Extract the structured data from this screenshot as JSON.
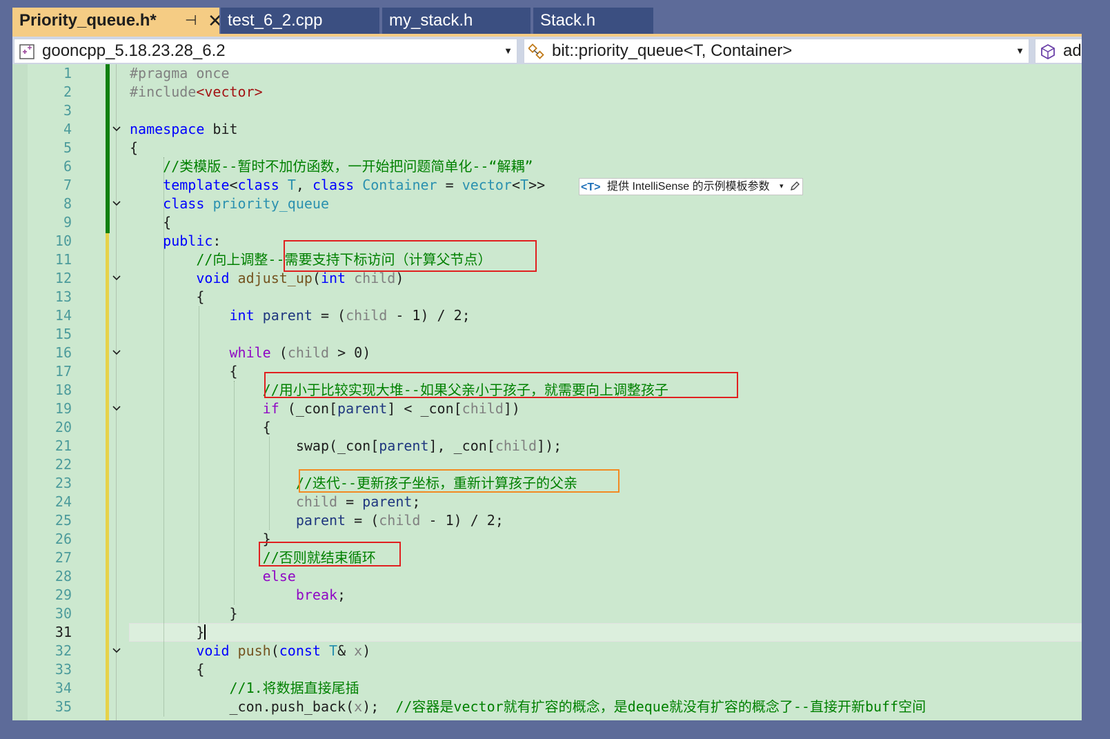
{
  "tabs": [
    {
      "label": "Priority_queue.h*",
      "active": true
    },
    {
      "label": "test_6_2.cpp",
      "active": false
    },
    {
      "label": "my_stack.h",
      "active": false
    },
    {
      "label": "Stack.h",
      "active": false
    }
  ],
  "tab_pin_icon": "pin-icon",
  "tab_close_icon": "close-icon",
  "navbar": {
    "project": "gooncpp_5.18.23.28_6.2",
    "scope": "bit::priority_queue<T, Container>",
    "member": "ad"
  },
  "intellisense": {
    "badge": "<T>",
    "text": "提供 IntelliSense 的示例模板参数",
    "arrow": "▾"
  },
  "current_line": 31,
  "lines": [
    {
      "n": "1",
      "t": [
        [
          "#pragma once",
          "pp"
        ]
      ]
    },
    {
      "n": "2",
      "t": [
        [
          "#include",
          "pp"
        ],
        [
          "<vector>",
          "str"
        ]
      ]
    },
    {
      "n": "3",
      "t": []
    },
    {
      "n": "4",
      "t": [
        [
          "namespace",
          "kw"
        ],
        [
          " bit",
          "pl"
        ]
      ]
    },
    {
      "n": "5",
      "t": [
        [
          "{",
          "pl"
        ]
      ]
    },
    {
      "n": "6",
      "t": [
        [
          "    ",
          "pl"
        ],
        [
          "//类模版--暂时不加仿函数，一开始把问题简单化--“解耦”",
          "cm"
        ]
      ]
    },
    {
      "n": "7",
      "t": [
        [
          "    ",
          "pl"
        ],
        [
          "template",
          "kw"
        ],
        [
          "<",
          "pl"
        ],
        [
          "class",
          "kw"
        ],
        [
          " ",
          "pl"
        ],
        [
          "T",
          "type"
        ],
        [
          ", ",
          "pl"
        ],
        [
          "class",
          "kw"
        ],
        [
          " ",
          "pl"
        ],
        [
          "Container",
          "type"
        ],
        [
          " = ",
          "pl"
        ],
        [
          "vector",
          "type"
        ],
        [
          "<",
          "pl"
        ],
        [
          "T",
          "type"
        ],
        [
          ">>",
          "pl"
        ]
      ]
    },
    {
      "n": "8",
      "t": [
        [
          "    ",
          "pl"
        ],
        [
          "class",
          "kw"
        ],
        [
          " ",
          "pl"
        ],
        [
          "priority_queue",
          "type"
        ]
      ]
    },
    {
      "n": "9",
      "t": [
        [
          "    {",
          "pl"
        ]
      ]
    },
    {
      "n": "10",
      "t": [
        [
          "    ",
          "pl"
        ],
        [
          "public",
          "kw"
        ],
        [
          ":",
          "pl"
        ]
      ]
    },
    {
      "n": "11",
      "t": [
        [
          "        ",
          "pl"
        ],
        [
          "//向上调整--需要支持下标访问（计算父节点）",
          "cm"
        ]
      ]
    },
    {
      "n": "12",
      "t": [
        [
          "        ",
          "pl"
        ],
        [
          "void",
          "kw"
        ],
        [
          " ",
          "pl"
        ],
        [
          "adjust_up",
          "fn"
        ],
        [
          "(",
          "pl"
        ],
        [
          "int",
          "kw"
        ],
        [
          " ",
          "pl"
        ],
        [
          "child",
          "par"
        ],
        [
          ")",
          "pl"
        ]
      ]
    },
    {
      "n": "13",
      "t": [
        [
          "        {",
          "pl"
        ]
      ]
    },
    {
      "n": "14",
      "t": [
        [
          "            ",
          "pl"
        ],
        [
          "int",
          "kw"
        ],
        [
          " ",
          "pl"
        ],
        [
          "parent",
          "mem"
        ],
        [
          " = (",
          "pl"
        ],
        [
          "child",
          "par"
        ],
        [
          " - 1) / 2;",
          "pl"
        ]
      ]
    },
    {
      "n": "15",
      "t": []
    },
    {
      "n": "16",
      "t": [
        [
          "            ",
          "pl"
        ],
        [
          "while",
          "ctrl"
        ],
        [
          " (",
          "pl"
        ],
        [
          "child",
          "par"
        ],
        [
          " > 0)",
          "pl"
        ]
      ]
    },
    {
      "n": "17",
      "t": [
        [
          "            {",
          "pl"
        ]
      ]
    },
    {
      "n": "18",
      "t": [
        [
          "                ",
          "pl"
        ],
        [
          "//用小于比较实现大堆--如果父亲小于孩子，就需要向上调整孩子",
          "cm"
        ]
      ]
    },
    {
      "n": "19",
      "t": [
        [
          "                ",
          "pl"
        ],
        [
          "if",
          "ctrl"
        ],
        [
          " (_con[",
          "pl"
        ],
        [
          "parent",
          "mem"
        ],
        [
          "] < _con[",
          "pl"
        ],
        [
          "child",
          "par"
        ],
        [
          "])",
          "pl"
        ]
      ]
    },
    {
      "n": "20",
      "t": [
        [
          "                {",
          "pl"
        ]
      ]
    },
    {
      "n": "21",
      "t": [
        [
          "                    ",
          "pl"
        ],
        [
          "swap",
          "pl"
        ],
        [
          "(_con[",
          "pl"
        ],
        [
          "parent",
          "mem"
        ],
        [
          "], _con[",
          "pl"
        ],
        [
          "child",
          "par"
        ],
        [
          "]);",
          "pl"
        ]
      ]
    },
    {
      "n": "22",
      "t": []
    },
    {
      "n": "23",
      "t": [
        [
          "                    ",
          "pl"
        ],
        [
          "//迭代--更新孩子坐标，重新计算孩子的父亲",
          "cm"
        ]
      ]
    },
    {
      "n": "24",
      "t": [
        [
          "                    ",
          "pl"
        ],
        [
          "child",
          "par"
        ],
        [
          " = ",
          "pl"
        ],
        [
          "parent",
          "mem"
        ],
        [
          ";",
          "pl"
        ]
      ]
    },
    {
      "n": "25",
      "t": [
        [
          "                    ",
          "pl"
        ],
        [
          "parent",
          "mem"
        ],
        [
          " = (",
          "pl"
        ],
        [
          "child",
          "par"
        ],
        [
          " - 1) / 2;",
          "pl"
        ]
      ]
    },
    {
      "n": "26",
      "t": [
        [
          "                }",
          "pl"
        ]
      ]
    },
    {
      "n": "27",
      "t": [
        [
          "                ",
          "pl"
        ],
        [
          "//否则就结束循环",
          "cm"
        ]
      ]
    },
    {
      "n": "28",
      "t": [
        [
          "                ",
          "pl"
        ],
        [
          "else",
          "ctrl"
        ]
      ]
    },
    {
      "n": "29",
      "t": [
        [
          "                    ",
          "pl"
        ],
        [
          "break",
          "ctrl"
        ],
        [
          ";",
          "pl"
        ]
      ]
    },
    {
      "n": "30",
      "t": [
        [
          "            }",
          "pl"
        ]
      ]
    },
    {
      "n": "31",
      "t": [
        [
          "        }",
          "pl"
        ]
      ]
    },
    {
      "n": "32",
      "t": [
        [
          "        ",
          "pl"
        ],
        [
          "void",
          "kw"
        ],
        [
          " ",
          "pl"
        ],
        [
          "push",
          "fn"
        ],
        [
          "(",
          "pl"
        ],
        [
          "const",
          "kw"
        ],
        [
          " ",
          "pl"
        ],
        [
          "T",
          "type"
        ],
        [
          "& ",
          "pl"
        ],
        [
          "x",
          "par"
        ],
        [
          ")",
          "pl"
        ]
      ]
    },
    {
      "n": "33",
      "t": [
        [
          "        {",
          "pl"
        ]
      ]
    },
    {
      "n": "34",
      "t": [
        [
          "            ",
          "pl"
        ],
        [
          "//1.将数据直接尾插",
          "cm"
        ]
      ]
    },
    {
      "n": "35",
      "t": [
        [
          "            ",
          "pl"
        ],
        [
          "_con.push_back(",
          "pl"
        ],
        [
          "x",
          "par"
        ],
        [
          ");  ",
          "pl"
        ],
        [
          "//容器是vector就有扩容的概念，是deque就没有扩容的概念了--直接开新buff空间",
          "cm"
        ]
      ]
    }
  ],
  "fold_lines": [
    "4",
    "8",
    "12",
    "16",
    "19",
    "32"
  ],
  "colors": {
    "editor_background": "#cce8cf",
    "keyword": "#0000ff",
    "comment": "#008000",
    "type": "#2b91af",
    "control": "#8f08c4",
    "annotation_red": "#e02020",
    "annotation_orange": "#f28a22",
    "active_tab": "#f5cc84"
  }
}
